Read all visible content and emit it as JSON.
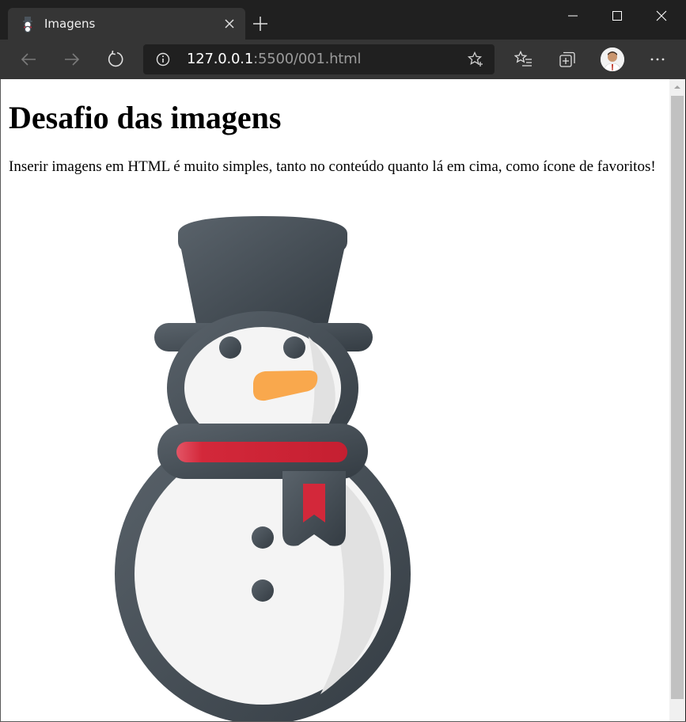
{
  "browser": {
    "tab": {
      "title": "Imagens",
      "favicon": "snowman-icon"
    },
    "url": {
      "host": "127.0.0.1",
      "rest": ":5500/001.html"
    },
    "window_controls": [
      "minimize-icon",
      "maximize-icon",
      "close-icon"
    ],
    "toolbar_icons": [
      "back-arrow-icon",
      "forward-arrow-icon",
      "refresh-icon",
      "site-info-icon",
      "add-favorite-star-icon",
      "favorites-list-icon",
      "collections-icon",
      "profile-avatar",
      "more-menu-icon"
    ]
  },
  "page": {
    "heading": "Desafio das imagens",
    "intro": "Inserir imagens em HTML é muito simples, tanto no conteúdo quanto lá em cima, como ícone de favoritos!",
    "image": {
      "subject": "snowman-illustration"
    }
  },
  "colors": {
    "chrome_dark": "#202020",
    "chrome_mid": "#353535",
    "snowman_outline": "#4b545c",
    "scarf_red": "#d3283a",
    "nose_orange": "#f9a84d"
  }
}
